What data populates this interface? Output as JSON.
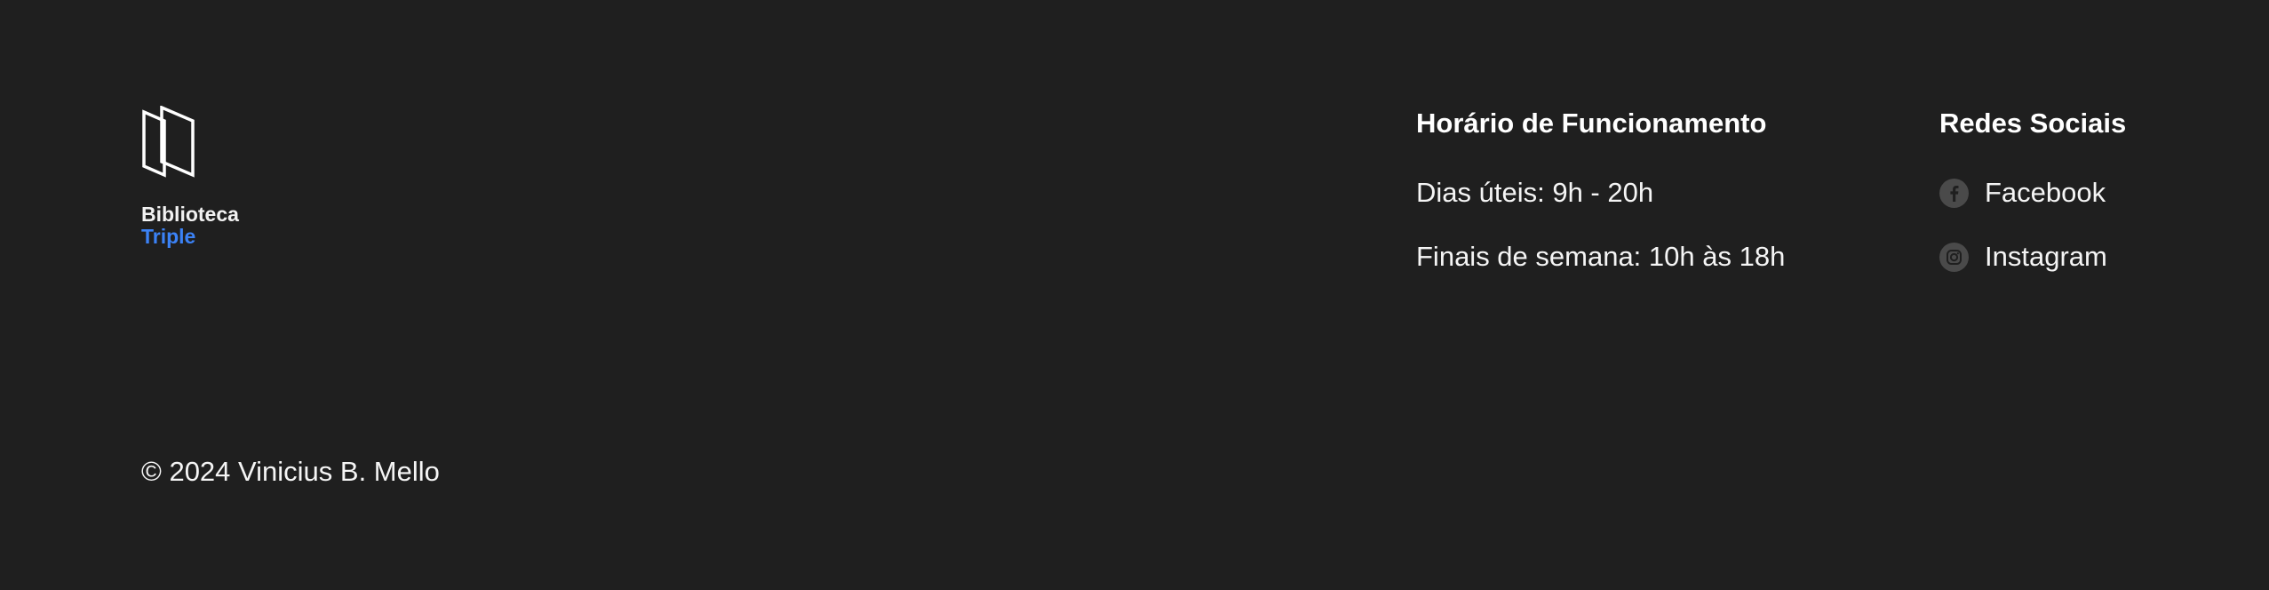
{
  "brand": {
    "logo_icon": "book-pages-logo-icon",
    "name_line1": "Biblioteca",
    "name_line2": "Triple",
    "accent_color": "#3b82f6"
  },
  "hours": {
    "title": "Horário de Funcionamento",
    "lines": [
      "Dias úteis: 9h - 20h",
      "Finais de semana: 10h às 18h"
    ]
  },
  "social": {
    "title": "Redes Sociais",
    "items": [
      {
        "label": "Facebook",
        "icon": "facebook-icon"
      },
      {
        "label": "Instagram",
        "icon": "instagram-icon"
      }
    ]
  },
  "copyright": "© 2024 Vinicius B. Mello",
  "colors": {
    "background": "#1f1f1f",
    "text": "#ffffff",
    "icon_circle": "#4a4a4a"
  }
}
